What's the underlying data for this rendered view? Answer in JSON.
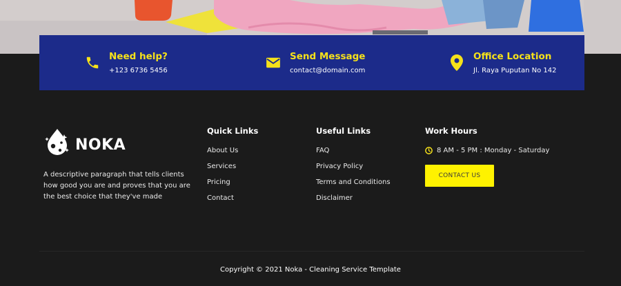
{
  "contact_bar": {
    "help": {
      "title": "Need help?",
      "value": "+123 6736 5456",
      "icon": "phone-icon"
    },
    "message": {
      "title": "Send Message",
      "value": "contact@domain.com",
      "icon": "envelope-icon"
    },
    "location": {
      "title": "Office Location",
      "value": "Jl. Raya Puputan No 142",
      "icon": "map-pin-icon"
    }
  },
  "brand": {
    "name": "NOKA",
    "logo_icon": "water-drop-logo-icon",
    "description": "A descriptive paragraph that tells clients how good you are and proves that you are the best choice that they've made"
  },
  "quick_links": {
    "title": "Quick Links",
    "items": [
      "About Us",
      "Services",
      "Pricing",
      "Contact"
    ]
  },
  "useful_links": {
    "title": "Useful Links",
    "items": [
      "FAQ",
      "Privacy Policy",
      "Terms and Conditions",
      "Disclaimer"
    ]
  },
  "work_hours": {
    "title": "Work Hours",
    "hours": "8 AM - 5 PM : Monday - Saturday",
    "icon": "clock-icon",
    "button_label": "CONTACT US"
  },
  "copyright": "Copyright © 2021 Noka - Cleaning Service Template",
  "colors": {
    "accent_yellow": "#f5e11a",
    "button_yellow": "#fff200",
    "bar_blue": "#1c2b8a",
    "footer_bg": "#1b1b1b"
  }
}
